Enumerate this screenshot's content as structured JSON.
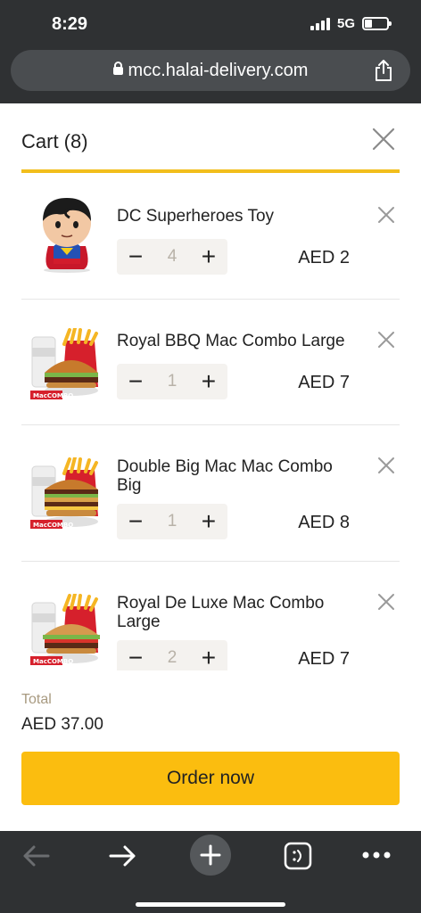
{
  "status_bar": {
    "time": "8:29",
    "network": "5G",
    "battery_level": 0.35
  },
  "browser": {
    "url": "mcc.halai-delivery.com"
  },
  "cart": {
    "title": "Cart (8)",
    "items": [
      {
        "name": "DC Superheroes Toy",
        "quantity": "4",
        "price": "AED 2",
        "image": "superhero-toy-image"
      },
      {
        "name": "Royal BBQ Mac Combo Large",
        "quantity": "1",
        "price": "AED 7",
        "image": "mac-combo-image"
      },
      {
        "name": "Double Big Mac Mac Combo Big",
        "quantity": "1",
        "price": "AED 8",
        "image": "mac-combo-image"
      },
      {
        "name": "Royal De Luxe Mac Combo Large",
        "quantity": "2",
        "price": "AED 7",
        "image": "mac-combo-image"
      }
    ],
    "combo_badge": "MacCOMBO",
    "total_label": "Total",
    "total_value": "AED 37.00",
    "order_button": "Order now",
    "stepper_minus": "−",
    "stepper_plus": "+"
  },
  "colors": {
    "accent": "#f2be1c",
    "order_button": "#fbbd0f",
    "chrome": "#2f3133"
  }
}
